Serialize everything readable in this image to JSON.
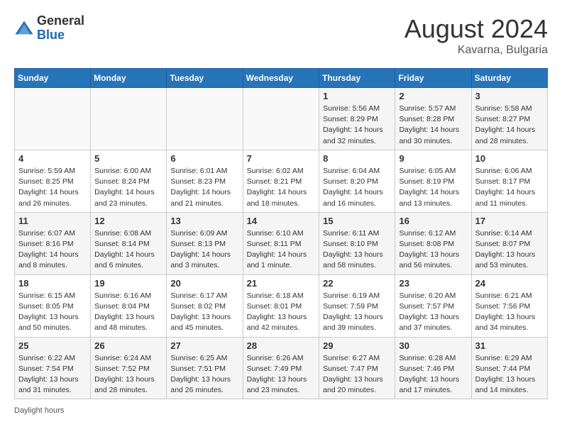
{
  "header": {
    "logo_general": "General",
    "logo_blue": "Blue",
    "month_year": "August 2024",
    "location": "Kavarna, Bulgaria"
  },
  "footer": {
    "daylight_label": "Daylight hours"
  },
  "days_of_week": [
    "Sunday",
    "Monday",
    "Tuesday",
    "Wednesday",
    "Thursday",
    "Friday",
    "Saturday"
  ],
  "weeks": [
    [
      {
        "day": "",
        "info": ""
      },
      {
        "day": "",
        "info": ""
      },
      {
        "day": "",
        "info": ""
      },
      {
        "day": "",
        "info": ""
      },
      {
        "day": "1",
        "info": "Sunrise: 5:56 AM\nSunset: 8:29 PM\nDaylight: 14 hours and 32 minutes."
      },
      {
        "day": "2",
        "info": "Sunrise: 5:57 AM\nSunset: 8:28 PM\nDaylight: 14 hours and 30 minutes."
      },
      {
        "day": "3",
        "info": "Sunrise: 5:58 AM\nSunset: 8:27 PM\nDaylight: 14 hours and 28 minutes."
      }
    ],
    [
      {
        "day": "4",
        "info": "Sunrise: 5:59 AM\nSunset: 8:25 PM\nDaylight: 14 hours and 26 minutes."
      },
      {
        "day": "5",
        "info": "Sunrise: 6:00 AM\nSunset: 8:24 PM\nDaylight: 14 hours and 23 minutes."
      },
      {
        "day": "6",
        "info": "Sunrise: 6:01 AM\nSunset: 8:23 PM\nDaylight: 14 hours and 21 minutes."
      },
      {
        "day": "7",
        "info": "Sunrise: 6:02 AM\nSunset: 8:21 PM\nDaylight: 14 hours and 18 minutes."
      },
      {
        "day": "8",
        "info": "Sunrise: 6:04 AM\nSunset: 8:20 PM\nDaylight: 14 hours and 16 minutes."
      },
      {
        "day": "9",
        "info": "Sunrise: 6:05 AM\nSunset: 8:19 PM\nDaylight: 14 hours and 13 minutes."
      },
      {
        "day": "10",
        "info": "Sunrise: 6:06 AM\nSunset: 8:17 PM\nDaylight: 14 hours and 11 minutes."
      }
    ],
    [
      {
        "day": "11",
        "info": "Sunrise: 6:07 AM\nSunset: 8:16 PM\nDaylight: 14 hours and 8 minutes."
      },
      {
        "day": "12",
        "info": "Sunrise: 6:08 AM\nSunset: 8:14 PM\nDaylight: 14 hours and 6 minutes."
      },
      {
        "day": "13",
        "info": "Sunrise: 6:09 AM\nSunset: 8:13 PM\nDaylight: 14 hours and 3 minutes."
      },
      {
        "day": "14",
        "info": "Sunrise: 6:10 AM\nSunset: 8:11 PM\nDaylight: 14 hours and 1 minute."
      },
      {
        "day": "15",
        "info": "Sunrise: 6:11 AM\nSunset: 8:10 PM\nDaylight: 13 hours and 58 minutes."
      },
      {
        "day": "16",
        "info": "Sunrise: 6:12 AM\nSunset: 8:08 PM\nDaylight: 13 hours and 56 minutes."
      },
      {
        "day": "17",
        "info": "Sunrise: 6:14 AM\nSunset: 8:07 PM\nDaylight: 13 hours and 53 minutes."
      }
    ],
    [
      {
        "day": "18",
        "info": "Sunrise: 6:15 AM\nSunset: 8:05 PM\nDaylight: 13 hours and 50 minutes."
      },
      {
        "day": "19",
        "info": "Sunrise: 6:16 AM\nSunset: 8:04 PM\nDaylight: 13 hours and 48 minutes."
      },
      {
        "day": "20",
        "info": "Sunrise: 6:17 AM\nSunset: 8:02 PM\nDaylight: 13 hours and 45 minutes."
      },
      {
        "day": "21",
        "info": "Sunrise: 6:18 AM\nSunset: 8:01 PM\nDaylight: 13 hours and 42 minutes."
      },
      {
        "day": "22",
        "info": "Sunrise: 6:19 AM\nSunset: 7:59 PM\nDaylight: 13 hours and 39 minutes."
      },
      {
        "day": "23",
        "info": "Sunrise: 6:20 AM\nSunset: 7:57 PM\nDaylight: 13 hours and 37 minutes."
      },
      {
        "day": "24",
        "info": "Sunrise: 6:21 AM\nSunset: 7:56 PM\nDaylight: 13 hours and 34 minutes."
      }
    ],
    [
      {
        "day": "25",
        "info": "Sunrise: 6:22 AM\nSunset: 7:54 PM\nDaylight: 13 hours and 31 minutes."
      },
      {
        "day": "26",
        "info": "Sunrise: 6:24 AM\nSunset: 7:52 PM\nDaylight: 13 hours and 28 minutes."
      },
      {
        "day": "27",
        "info": "Sunrise: 6:25 AM\nSunset: 7:51 PM\nDaylight: 13 hours and 26 minutes."
      },
      {
        "day": "28",
        "info": "Sunrise: 6:26 AM\nSunset: 7:49 PM\nDaylight: 13 hours and 23 minutes."
      },
      {
        "day": "29",
        "info": "Sunrise: 6:27 AM\nSunset: 7:47 PM\nDaylight: 13 hours and 20 minutes."
      },
      {
        "day": "30",
        "info": "Sunrise: 6:28 AM\nSunset: 7:46 PM\nDaylight: 13 hours and 17 minutes."
      },
      {
        "day": "31",
        "info": "Sunrise: 6:29 AM\nSunset: 7:44 PM\nDaylight: 13 hours and 14 minutes."
      }
    ]
  ]
}
